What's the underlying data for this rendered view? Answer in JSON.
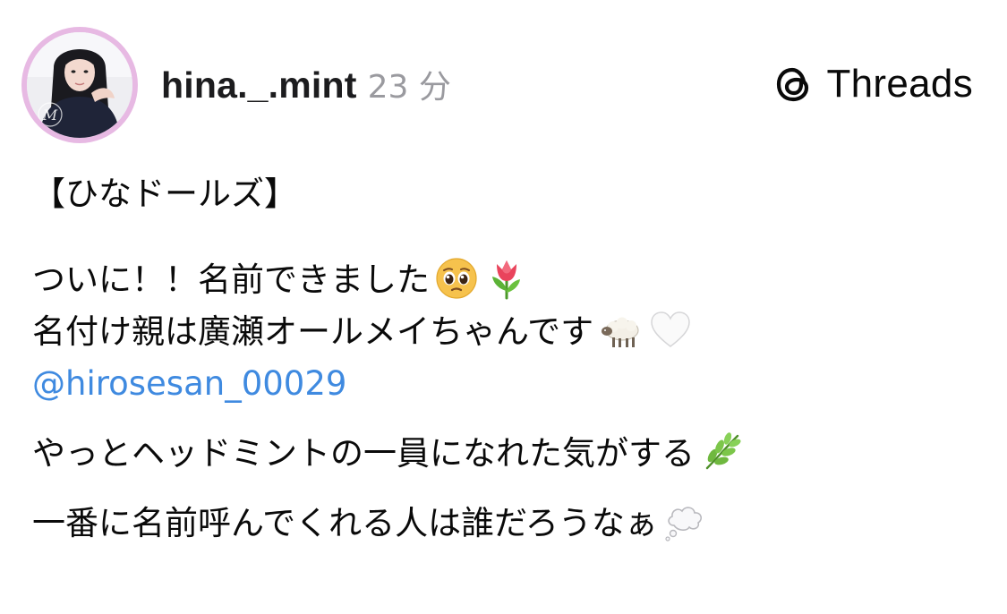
{
  "header": {
    "username": "hina._.mint",
    "timestamp": "23 分",
    "brand_name": "Threads",
    "avatar": {
      "monogram": "M"
    }
  },
  "post": {
    "title": "【ひなドールズ】",
    "line1": "ついに！！名前できました",
    "line2": "名付け親は廣瀬オールメイちゃんです",
    "mention": "@hirosesan_00029",
    "line3": "やっとヘッドミントの一員になれた気がする",
    "line4": "一番に名前呼んでくれる人は誰だろうなぁ"
  },
  "emojis": {
    "line1": [
      "pleading-face-emoji",
      "tulip-emoji"
    ],
    "line2": [
      "sheep-emoji",
      "white-heart-emoji"
    ],
    "line3": [
      "herb-emoji"
    ],
    "line4": [
      "thought-balloon-emoji"
    ]
  },
  "colors": {
    "mention": "#3f8ae0",
    "avatar_ring": "#e7b9e3",
    "timestamp": "#9a9a9f"
  }
}
